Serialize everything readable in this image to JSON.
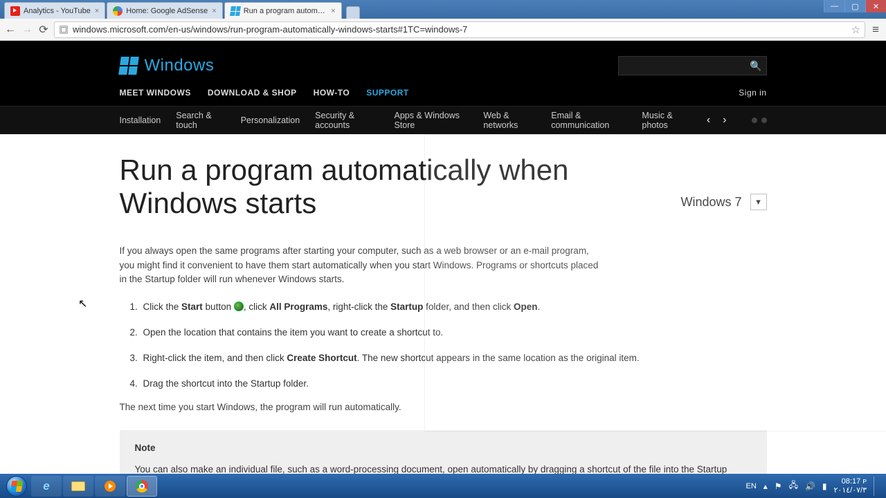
{
  "browser": {
    "tabs": [
      {
        "title": "Analytics - YouTube"
      },
      {
        "title": "Home: Google AdSense"
      },
      {
        "title": "Run a program automatic"
      }
    ],
    "url": "windows.microsoft.com/en-us/windows/run-program-automatically-windows-starts#1TC=windows-7",
    "win_buttons": {
      "min": "—",
      "max": "▢",
      "close": "✕"
    }
  },
  "header": {
    "brand": "Windows",
    "search_placeholder": "",
    "nav": [
      "MEET WINDOWS",
      "DOWNLOAD & SHOP",
      "HOW-TO",
      "SUPPORT"
    ],
    "active_nav": "SUPPORT",
    "signin": "Sign in",
    "subnav": [
      "Installation",
      "Search & touch",
      "Personalization",
      "Security & accounts",
      "Apps & Windows Store",
      "Web & networks",
      "Email & communication",
      "Music & photos"
    ]
  },
  "article": {
    "title": "Run a program automatically when Windows starts",
    "version_label": "Windows 7",
    "intro": "If you always open the same programs after starting your computer, such as a web browser or an e-mail program, you might find it convenient to have them start automatically when you start Windows. Programs or shortcuts placed in the Startup folder will run whenever Windows starts.",
    "steps": {
      "s1_a": "Click the ",
      "s1_start": "Start",
      "s1_b": " button ",
      "s1_c": ", click ",
      "s1_allprograms": "All Programs",
      "s1_d": ", right-click the ",
      "s1_startup": "Startup",
      "s1_e": " folder, and then click ",
      "s1_open": "Open",
      "s1_f": ".",
      "s2": "Open the location that contains the item you want to create a shortcut to.",
      "s3_a": "Right-click the item, and then click ",
      "s3_cs": "Create Shortcut",
      "s3_b": ". The new shortcut appears in the same location as the original item.",
      "s4": "Drag the shortcut into the Startup folder."
    },
    "followup": "The next time you start Windows, the program will run automatically.",
    "note_heading": "Note",
    "note_body": "You can also make an individual file, such as a word-processing document, open automatically by dragging a shortcut of the file into the Startup folder."
  },
  "taskbar": {
    "lang": "EN",
    "time": "08:17 ᴘ",
    "date": "٢٠١٤/٠٧/٣"
  }
}
